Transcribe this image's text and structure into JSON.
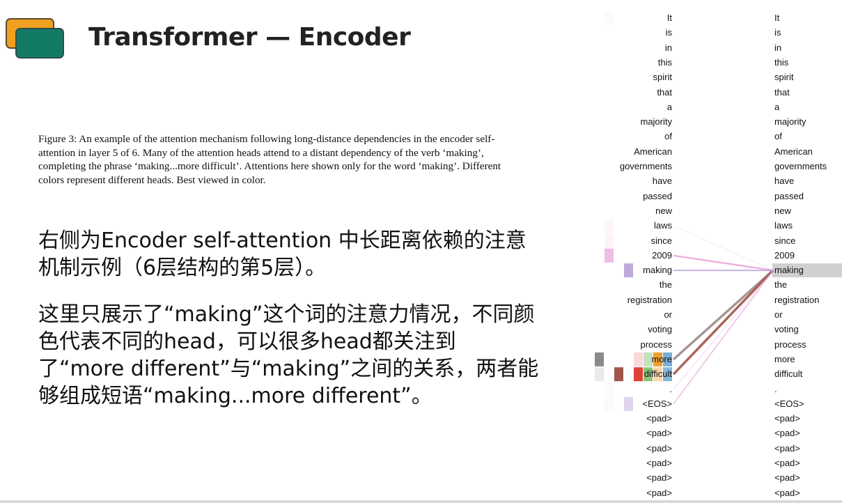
{
  "slide": {
    "title": "Transformer — Encoder",
    "caption": "Figure 3: An example of the attention mechanism following long-distance dependencies in the encoder self-attention in layer 5 of 6. Many of the attention heads attend to a distant dependency of the verb ‘making’, completing the phrase ‘making...more difficult’. Attentions here shown only for the word ‘making’. Different colors represent different heads. Best viewed in color.",
    "paragraph1": "右侧为Encoder self-attention 中长距离依赖的注意机制示例（6层结构的第5层）。",
    "paragraph2": "这里只展示了“making”这个词的注意力情况，不同颜色代表不同的head，可以很多head都关注到了“more different”与“making”之间的关系，两者能够组成短语“making...more different”。"
  },
  "attention": {
    "tokens": [
      "It",
      "is",
      "in",
      "this",
      "spirit",
      "that",
      "a",
      "majority",
      "of",
      "American",
      "governments",
      "have",
      "passed",
      "new",
      "laws",
      "since",
      "2009",
      "making",
      "the",
      "registration",
      "or",
      "voting",
      "process",
      "more",
      "difficult",
      ".",
      "<EOS>",
      "<pad>",
      "<pad>",
      "<pad>",
      "<pad>",
      "<pad>",
      "<pad>"
    ],
    "query_token": "making",
    "highlight_color": "#d0d0d0",
    "head_colors": [
      "#8a8a8a",
      "#a0564a",
      "#e0403a",
      "#8cc47a",
      "#f0a030",
      "#7ab0d8",
      "#e8a0d8",
      "#b8a0d8"
    ]
  }
}
